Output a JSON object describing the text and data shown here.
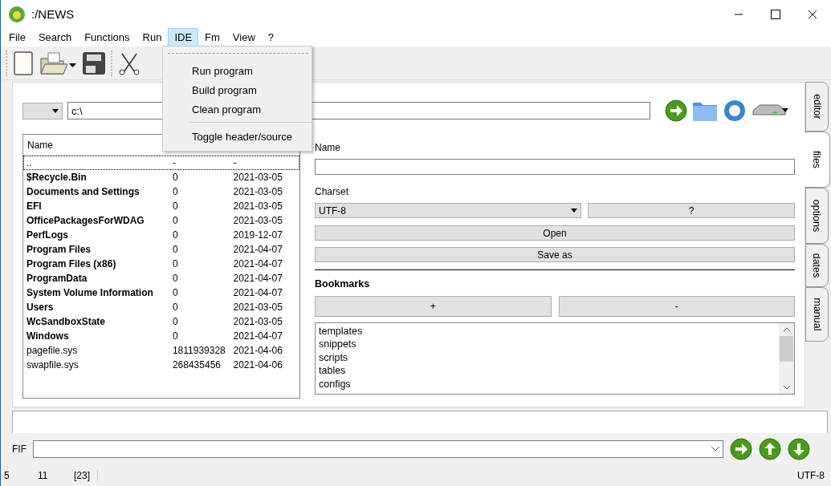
{
  "window": {
    "title": ":/NEWS"
  },
  "menu_bar": [
    {
      "label": "File",
      "selected": false
    },
    {
      "label": "Search",
      "selected": false
    },
    {
      "label": "Functions",
      "selected": false
    },
    {
      "label": "Run",
      "selected": false
    },
    {
      "label": "IDE",
      "selected": true
    },
    {
      "label": "Fm",
      "selected": false
    },
    {
      "label": "View",
      "selected": false
    },
    {
      "label": "?",
      "selected": false
    }
  ],
  "open_menu": {
    "items": [
      {
        "kind": "tearoff"
      },
      {
        "kind": "item",
        "label": "Run program"
      },
      {
        "kind": "item",
        "label": "Build program"
      },
      {
        "kind": "item",
        "label": "Clean program"
      },
      {
        "kind": "separator"
      },
      {
        "kind": "item",
        "label": "Toggle header/source"
      }
    ]
  },
  "path_bar": {
    "path": "c:\\"
  },
  "file_table": {
    "columns": [
      "Name"
    ],
    "rows": [
      {
        "name": "..",
        "size": "-",
        "modified": "-",
        "folder": false,
        "selected": true
      },
      {
        "name": "$Recycle.Bin",
        "size": "0",
        "modified": "2021-03-05",
        "folder": true,
        "selected": false
      },
      {
        "name": "Documents and Settings",
        "size": "0",
        "modified": "2021-03-05",
        "folder": true,
        "selected": false
      },
      {
        "name": "EFI",
        "size": "0",
        "modified": "2021-03-05",
        "folder": true,
        "selected": false
      },
      {
        "name": "OfficePackagesForWDAG",
        "size": "0",
        "modified": "2021-03-05",
        "folder": true,
        "selected": false
      },
      {
        "name": "PerfLogs",
        "size": "0",
        "modified": "2019-12-07",
        "folder": true,
        "selected": false
      },
      {
        "name": "Program Files",
        "size": "0",
        "modified": "2021-04-07",
        "folder": true,
        "selected": false
      },
      {
        "name": "Program Files (x86)",
        "size": "0",
        "modified": "2021-04-07",
        "folder": true,
        "selected": false
      },
      {
        "name": "ProgramData",
        "size": "0",
        "modified": "2021-04-07",
        "folder": true,
        "selected": false
      },
      {
        "name": "System Volume Information",
        "size": "0",
        "modified": "2021-04-07",
        "folder": true,
        "selected": false
      },
      {
        "name": "Users",
        "size": "0",
        "modified": "2021-03-05",
        "folder": true,
        "selected": false
      },
      {
        "name": "WcSandboxState",
        "size": "0",
        "modified": "2021-03-05",
        "folder": true,
        "selected": false
      },
      {
        "name": "Windows",
        "size": "0",
        "modified": "2021-04-07",
        "folder": true,
        "selected": false
      },
      {
        "name": "pagefile.sys",
        "size": "1811939328",
        "modified": "2021-04-06",
        "folder": false,
        "selected": false
      },
      {
        "name": "swapfile.sys",
        "size": "268435456",
        "modified": "2021-04-06",
        "folder": false,
        "selected": false
      }
    ]
  },
  "file_panel": {
    "name_label": "Name",
    "charset_label": "Charset",
    "charset": "UTF-8",
    "charset_help": "?",
    "open_button": "Open",
    "save_button": "Save as",
    "bookmarks_title": "Bookmarks",
    "add_button": "+",
    "remove_button": "-",
    "bookmarks": [
      "templates",
      "snippets",
      "scripts",
      "tables",
      "configs"
    ]
  },
  "side_tabs": [
    {
      "label": "editor",
      "selected": false
    },
    {
      "label": "files",
      "selected": true
    },
    {
      "label": "options",
      "selected": false
    },
    {
      "label": "dates",
      "selected": false
    },
    {
      "label": "manual",
      "selected": false
    }
  ],
  "fif": {
    "label": "FIF"
  },
  "status_bar": {
    "line": "5",
    "column": "11",
    "position": "[23]",
    "encoding": "UTF-8"
  }
}
